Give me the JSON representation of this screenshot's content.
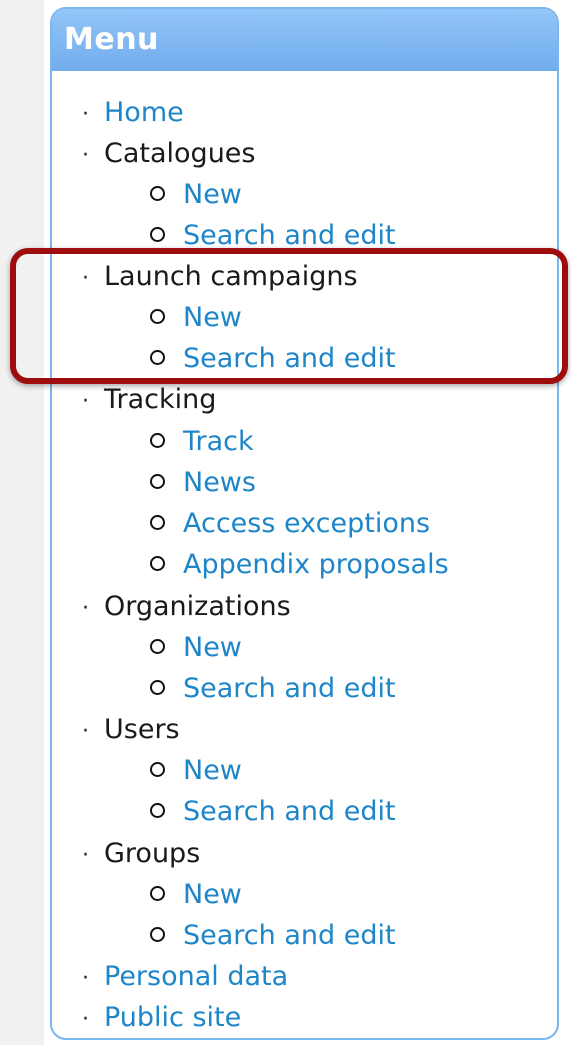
{
  "menu": {
    "title": "Menu",
    "home": "Home",
    "catalogues": {
      "label": "Catalogues",
      "new": "New",
      "search": "Search and edit"
    },
    "launch_campaigns": {
      "label": "Launch campaigns",
      "new": "New",
      "search": "Search and edit"
    },
    "tracking": {
      "label": "Tracking",
      "track": "Track",
      "news": "News",
      "access_exceptions": "Access exceptions",
      "appendix_proposals": "Appendix proposals"
    },
    "organizations": {
      "label": "Organizations",
      "new": "New",
      "search": "Search and edit"
    },
    "users": {
      "label": "Users",
      "new": "New",
      "search": "Search and edit"
    },
    "groups": {
      "label": "Groups",
      "new": "New",
      "search": "Search and edit"
    },
    "personal_data": "Personal data",
    "public_site": "Public site"
  },
  "colors": {
    "header_bg": "#7ab6f0",
    "link": "#1e86c8",
    "highlight": "#9e0d0d"
  }
}
